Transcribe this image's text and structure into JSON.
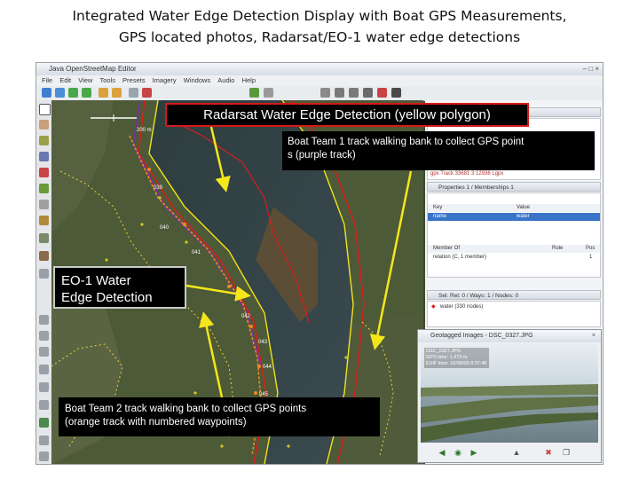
{
  "slide": {
    "title_line1": "Integrated Water Edge Detection Display with Boat GPS Measurements,",
    "title_line2": "GPS located photos, Radarsat/EO-1 water edge detections"
  },
  "app": {
    "window_title": "Java OpenStreetMap Editor",
    "menu": [
      "File",
      "Edit",
      "View",
      "Tools",
      "Presets",
      "Imagery",
      "Windows",
      "Audio",
      "Help"
    ]
  },
  "map": {
    "scale_label": "200 m",
    "waypoint_labels": [
      "039",
      "040",
      "041",
      "042",
      "043",
      "044",
      "045"
    ]
  },
  "side_panel": {
    "gpx_layer_label": "gpx Track 33681 3 12936 Lgpx",
    "properties_header": "Properties 1 / Memberships 1",
    "properties_columns": [
      "Key",
      "Value"
    ],
    "properties_row": {
      "key": "name",
      "value": "water"
    },
    "membership_columns": [
      "Member Of",
      "Role",
      "Pos"
    ],
    "membership_row": {
      "member_of": "relation (C, 1 member)",
      "role": "",
      "pos": "1"
    },
    "selection_header": "Sel: Rel: 0 / Ways: 1 / Nodes: 0",
    "selection_item": "water (330 nodes)"
  },
  "photo_window": {
    "title": "Geotagged Images - DSC_0327.JPG",
    "filename": "DSC_0327.JPG",
    "info_line2": "GPS time: 1,473 m",
    "info_line3": "EXIF time: 10/08/09 8:37:46"
  },
  "callouts": {
    "radarsat": "Radarsat Water Edge Detection (yellow polygon)",
    "team1_line1": "Boat Team 1 track walking bank to collect  GPS point",
    "team1_line2": "s (purple track)",
    "eo1_line1": "EO-1 Water",
    "eo1_line2": "Edge Detection",
    "team2_line1": "Boat Team 2 track walking bank to collect  GPS points",
    "team2_line2": "(orange track with numbered waypoints)"
  },
  "colors": {
    "radarsat_polygon": "#f2e21a",
    "eo1_edge": "#d61e1e",
    "team1_track": "#7a2fa0",
    "team2_track": "#f08a1e",
    "arrow": "#f5e61a"
  }
}
